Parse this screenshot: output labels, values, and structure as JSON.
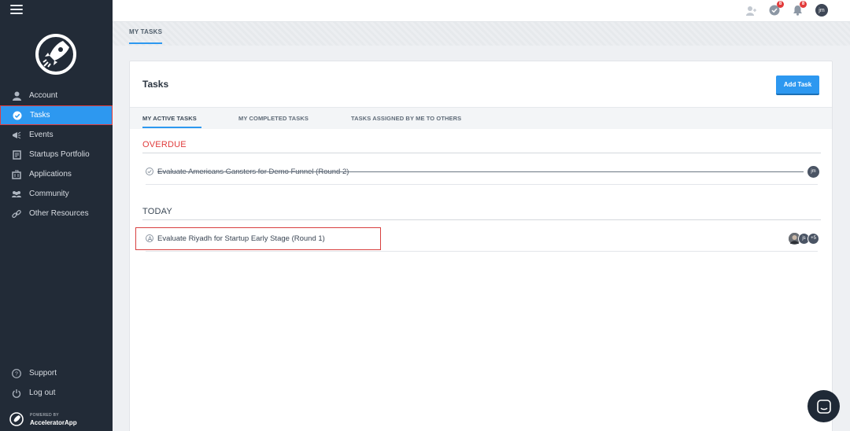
{
  "sidebar": {
    "items": [
      {
        "label": "Account",
        "icon": "user-icon"
      },
      {
        "label": "Tasks",
        "icon": "check-circle-icon"
      },
      {
        "label": "Events",
        "icon": "megaphone-icon"
      },
      {
        "label": "Startups Portfolio",
        "icon": "book-icon"
      },
      {
        "label": "Applications",
        "icon": "building-icon"
      },
      {
        "label": "Community",
        "icon": "people-icon"
      },
      {
        "label": "Other Resources",
        "icon": "link-icon"
      }
    ],
    "bottom": [
      {
        "label": "Support",
        "icon": "question-icon"
      },
      {
        "label": "Log out",
        "icon": "power-icon"
      }
    ],
    "powered_by": "POWERED BY",
    "brand": "AcceleratorApp"
  },
  "topbar": {
    "tasks_badge": "8",
    "notifications_badge": "8",
    "avatar_initials": "jm"
  },
  "subheader": {
    "tab": "MY TASKS"
  },
  "card": {
    "title": "Tasks",
    "add_button": "Add Task",
    "tabs": [
      "MY ACTIVE TASKS",
      "MY COMPLETED TASKS",
      "TASKS ASSIGNED BY ME TO OTHERS"
    ]
  },
  "sections": {
    "overdue": {
      "title": "OVERDUE",
      "task": "Evaluate Americans Gansters for Demo Funnel (Round 2)",
      "avatar": "jm"
    },
    "today": {
      "title": "TODAY",
      "task": "Evaluate Riyadh for Startup Early Stage (Round 1)",
      "avatars": [
        "js",
        "+5"
      ]
    }
  },
  "colors": {
    "sidebar_bg": "#222b37",
    "accent": "#2d98f0",
    "overdue": "#e03c3c"
  }
}
